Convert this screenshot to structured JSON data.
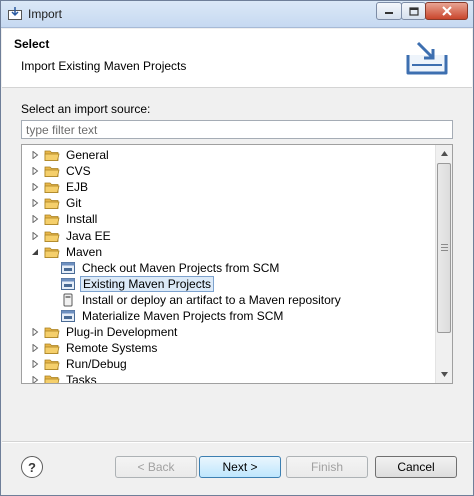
{
  "window": {
    "title": "Import"
  },
  "header": {
    "title": "Select",
    "description": "Import Existing Maven Projects"
  },
  "body": {
    "source_label": "Select an import source:",
    "filter_placeholder": "type filter text",
    "tree": [
      {
        "label": "General",
        "type": "folder",
        "expanded": false,
        "level": 0
      },
      {
        "label": "CVS",
        "type": "folder",
        "expanded": false,
        "level": 0
      },
      {
        "label": "EJB",
        "type": "folder",
        "expanded": false,
        "level": 0
      },
      {
        "label": "Git",
        "type": "folder",
        "expanded": false,
        "level": 0
      },
      {
        "label": "Install",
        "type": "folder",
        "expanded": false,
        "level": 0
      },
      {
        "label": "Java EE",
        "type": "folder",
        "expanded": false,
        "level": 0
      },
      {
        "label": "Maven",
        "type": "folder",
        "expanded": true,
        "level": 0
      },
      {
        "label": "Check out Maven Projects from SCM",
        "type": "maven-wizard",
        "level": 1
      },
      {
        "label": "Existing Maven Projects",
        "type": "maven-wizard",
        "level": 1,
        "selected": true
      },
      {
        "label": "Install or deploy an artifact to a Maven repository",
        "type": "jar",
        "level": 1
      },
      {
        "label": "Materialize Maven Projects from SCM",
        "type": "maven-wizard",
        "level": 1
      },
      {
        "label": "Plug-in Development",
        "type": "folder",
        "expanded": false,
        "level": 0
      },
      {
        "label": "Remote Systems",
        "type": "folder",
        "expanded": false,
        "level": 0
      },
      {
        "label": "Run/Debug",
        "type": "folder",
        "expanded": false,
        "level": 0
      },
      {
        "label": "Tasks",
        "type": "folder",
        "expanded": false,
        "level": 0
      }
    ]
  },
  "footer": {
    "help_label": "?",
    "back_label": "< Back",
    "next_label": "Next >",
    "finish_label": "Finish",
    "cancel_label": "Cancel"
  },
  "colors": {
    "folder": "#e8b64a",
    "selection": "#dceaf8",
    "selection_border": "#7da2ce"
  }
}
